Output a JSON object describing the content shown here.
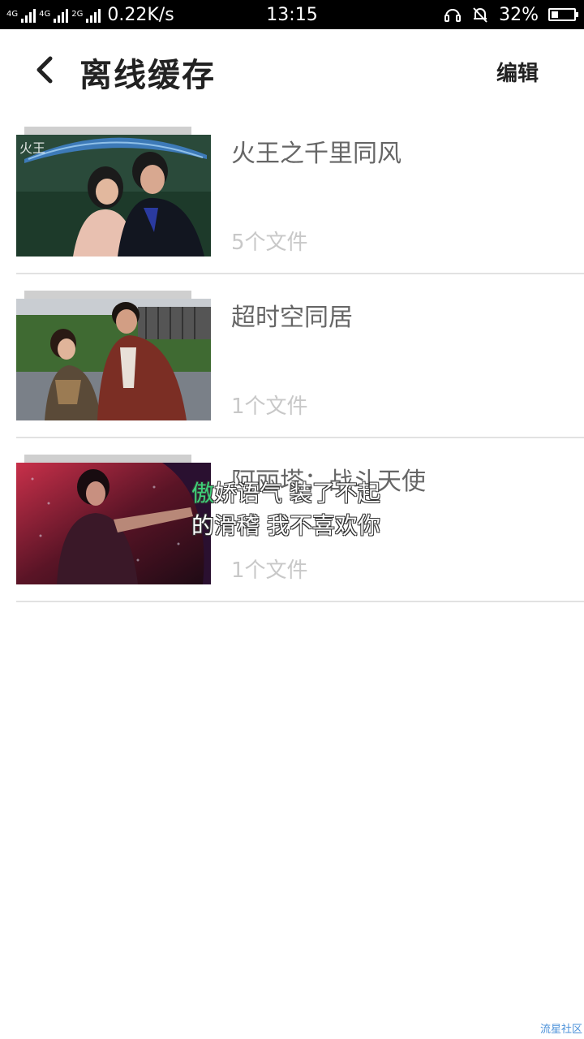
{
  "status_bar": {
    "net1": "4G",
    "net2": "4G",
    "net3": "2G",
    "speed": "0.22K/s",
    "time": "13:15",
    "battery": "32%",
    "battery_level": 0.32
  },
  "header": {
    "title": "离线缓存",
    "edit_label": "编辑"
  },
  "items": [
    {
      "title": "火王之千里同风",
      "count": "5个文件"
    },
    {
      "title": "超时空同居",
      "count": "1个文件"
    },
    {
      "title": "阿丽塔：战斗天使",
      "count": "1个文件"
    }
  ],
  "subtitle": {
    "line1_highlight": "傲",
    "line1_rest": "娇语气 装了不起",
    "line2": "的滑稽 我不喜欢你"
  },
  "watermark": "流星社区"
}
